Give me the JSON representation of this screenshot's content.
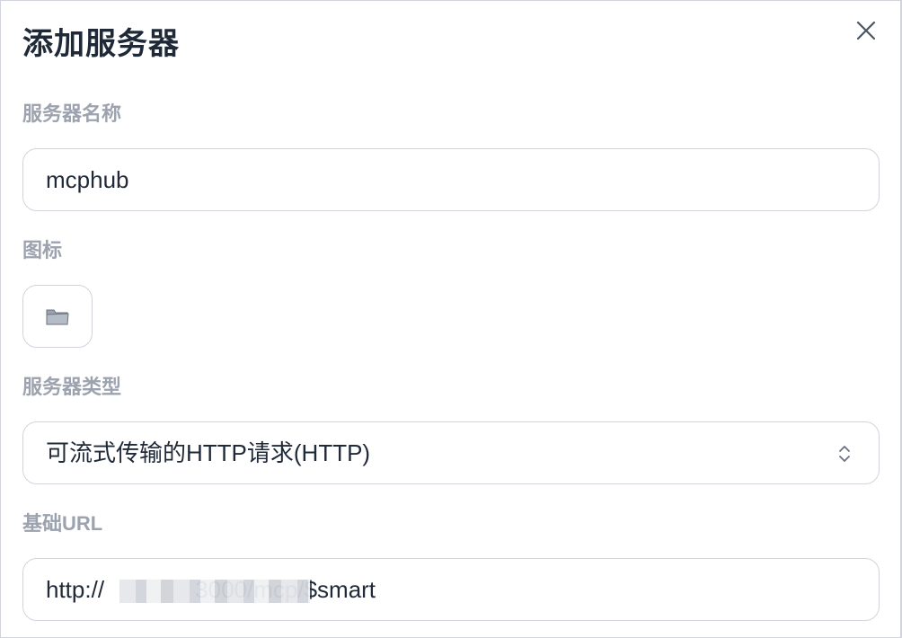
{
  "dialog": {
    "title": "添加服务器"
  },
  "fields": {
    "name": {
      "label": "服务器名称",
      "value": "mcphub"
    },
    "icon": {
      "label": "图标",
      "icon": "folder-icon"
    },
    "type": {
      "label": "服务器类型",
      "selected": "可流式传输的HTTP请求(HTTP)"
    },
    "base_url": {
      "label": "基础URL",
      "value": "http://              3000/mcp/$smart"
    }
  },
  "colors": {
    "title": "#1f2937",
    "label": "#9ca3af",
    "border": "#d1d5db",
    "text": "#1f2937"
  }
}
